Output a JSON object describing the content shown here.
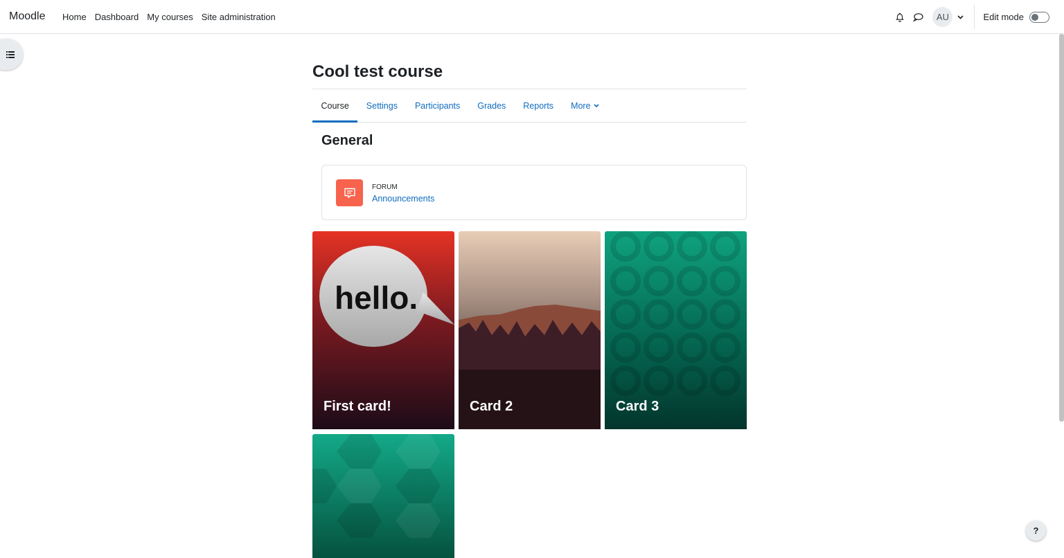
{
  "navbar": {
    "brand": "Moodle",
    "items": [
      {
        "label": "Home"
      },
      {
        "label": "Dashboard"
      },
      {
        "label": "My courses"
      },
      {
        "label": "Site administration"
      }
    ],
    "avatar_initials": "AU",
    "edit_mode_label": "Edit mode",
    "edit_mode_on": false
  },
  "course": {
    "title": "Cool test course",
    "tabs": [
      {
        "label": "Course",
        "active": true
      },
      {
        "label": "Settings"
      },
      {
        "label": "Participants"
      },
      {
        "label": "Grades"
      },
      {
        "label": "Reports"
      },
      {
        "label": "More"
      }
    ],
    "section_title": "General",
    "activity": {
      "type": "Forum",
      "name": "Announcements",
      "icon": "forum-icon",
      "icon_color": "#f7634d"
    },
    "cards": [
      {
        "title": "First card!",
        "image_text": "hello."
      },
      {
        "title": "Card 2"
      },
      {
        "title": "Card 3"
      },
      {
        "title": ""
      }
    ]
  },
  "colors": {
    "link": "#0f6cbf",
    "text": "#1d2125",
    "border": "#dee2e6"
  },
  "help_label": "?"
}
